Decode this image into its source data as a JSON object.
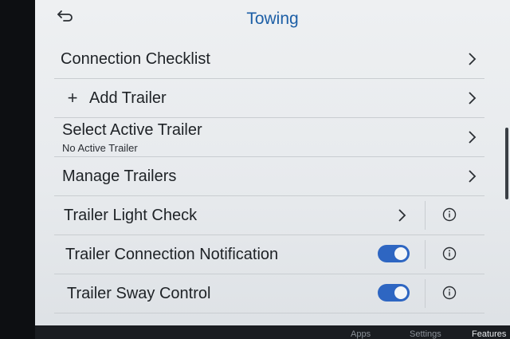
{
  "header": {
    "title": "Towing"
  },
  "rows": [
    {
      "label": "Connection Checklist"
    },
    {
      "label": "Add Trailer"
    },
    {
      "label": "Select Active Trailer",
      "sub": "No Active Trailer"
    },
    {
      "label": "Manage Trailers"
    },
    {
      "label": "Trailer Light Check"
    },
    {
      "label": "Trailer Connection Notification",
      "toggle_on": true
    },
    {
      "label": "Trailer Sway Control",
      "toggle_on": true
    }
  ],
  "bottom_nav": {
    "apps": "Apps",
    "settings": "Settings",
    "features": "Features"
  },
  "colors": {
    "accent": "#1d5fa6",
    "toggle_on": "#2e66c2"
  }
}
